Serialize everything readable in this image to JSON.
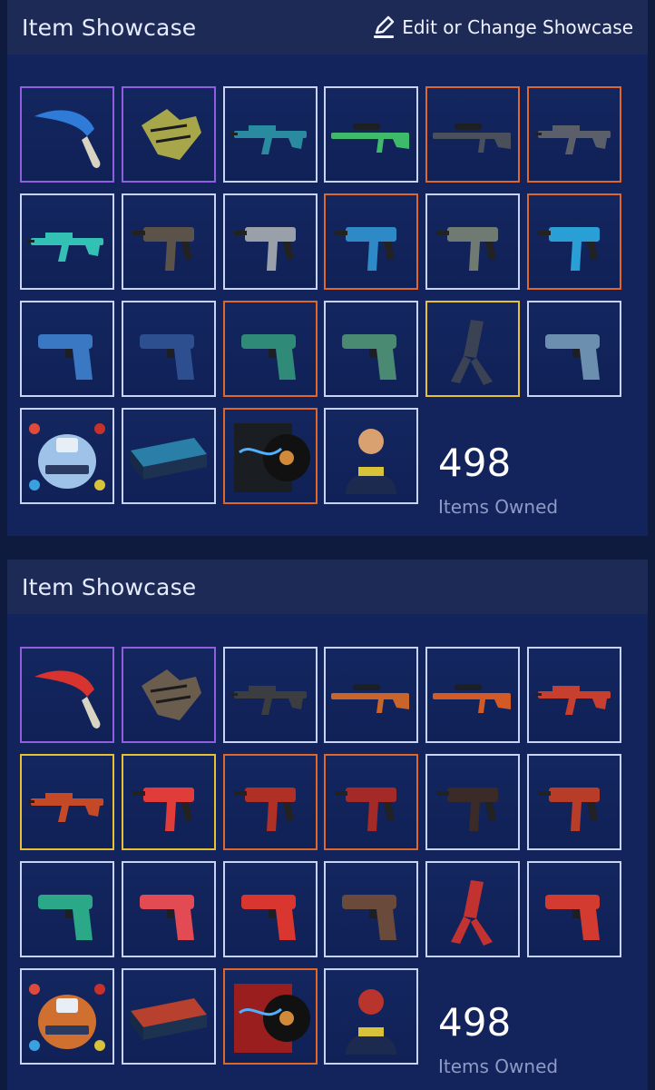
{
  "colors": {
    "background": "#0f1a3f",
    "panel": "#13245c",
    "header": "#1d2a55",
    "border_default": "#c9d3f2",
    "border_purple": "#8f5fe0",
    "border_orange": "#e0672a",
    "border_gold": "#e8c132"
  },
  "showcases": [
    {
      "title": "Item Showcase",
      "edit_label": "Edit or Change Showcase",
      "owned_count": "498",
      "owned_label": "Items Owned",
      "items": [
        {
          "name": "karambit-knife",
          "rarity": "purple",
          "icon": "knife-icon",
          "color": "#2f7bd8"
        },
        {
          "name": "gloves",
          "rarity": "purple",
          "icon": "gloves-icon",
          "color": "#a8a64a"
        },
        {
          "name": "m4a1-s-rifle",
          "rarity": "default",
          "icon": "rifle-icon",
          "color": "#2a8aa0"
        },
        {
          "name": "awp-sniper",
          "rarity": "default",
          "icon": "sniper-icon",
          "color": "#3dbb6a"
        },
        {
          "name": "ssg08-sniper",
          "rarity": "orange",
          "icon": "sniper-icon",
          "color": "#4a4f5c"
        },
        {
          "name": "aug-rifle",
          "rarity": "orange",
          "icon": "rifle-icon",
          "color": "#5a5f6a"
        },
        {
          "name": "famas-rifle",
          "rarity": "default",
          "icon": "rifle-icon",
          "color": "#33c0b5"
        },
        {
          "name": "pp-bizon-smg",
          "rarity": "default",
          "icon": "smg-icon",
          "color": "#5b524a"
        },
        {
          "name": "mp7-smg",
          "rarity": "default",
          "icon": "smg-icon",
          "color": "#9aa0aa"
        },
        {
          "name": "mp9-smg",
          "rarity": "orange",
          "icon": "smg-icon",
          "color": "#2d8ac6"
        },
        {
          "name": "p90-smg",
          "rarity": "default",
          "icon": "smg-icon",
          "color": "#6f7a72"
        },
        {
          "name": "ump45-smg",
          "rarity": "orange",
          "icon": "smg-icon",
          "color": "#2a9fd6"
        },
        {
          "name": "glock-pistol",
          "rarity": "default",
          "icon": "pistol-icon",
          "color": "#3b78c4"
        },
        {
          "name": "usp-s-pistol",
          "rarity": "default",
          "icon": "pistol-icon",
          "color": "#2e4f8f"
        },
        {
          "name": "p250-pistol",
          "rarity": "orange",
          "icon": "pistol-icon",
          "color": "#2f8a78"
        },
        {
          "name": "five-seven-pistol",
          "rarity": "default",
          "icon": "pistol-icon",
          "color": "#4a8a72"
        },
        {
          "name": "dual-berettas-pistol",
          "rarity": "gold",
          "icon": "dual-pistol-icon",
          "color": "#3a4254"
        },
        {
          "name": "desert-eagle-pistol",
          "rarity": "default",
          "icon": "pistol-icon",
          "color": "#6c8fb0"
        },
        {
          "name": "legends-sticker-capsule",
          "rarity": "default",
          "icon": "capsule-icon",
          "color": "#9fc2e8"
        },
        {
          "name": "souvenir-package",
          "rarity": "default",
          "icon": "package-icon",
          "color": "#2a7fa8"
        },
        {
          "name": "music-kit",
          "rarity": "orange",
          "icon": "music-kit-icon",
          "color": "#1a1d22"
        },
        {
          "name": "fbi-agent",
          "rarity": "default",
          "icon": "agent-icon",
          "color": "#d9a070"
        }
      ]
    },
    {
      "title": "Item Showcase",
      "edit_label": "",
      "owned_count": "498",
      "owned_label": "Items Owned",
      "items": [
        {
          "name": "huntsman-knife",
          "rarity": "purple",
          "icon": "knife-icon",
          "color": "#d8332e"
        },
        {
          "name": "gloves",
          "rarity": "purple",
          "icon": "gloves-icon",
          "color": "#6a5d4e"
        },
        {
          "name": "ak47-rifle",
          "rarity": "default",
          "icon": "rifle-icon",
          "color": "#3b3d40"
        },
        {
          "name": "awp-sniper",
          "rarity": "default",
          "icon": "sniper-icon",
          "color": "#c9642a"
        },
        {
          "name": "ssg08-sniper",
          "rarity": "default",
          "icon": "sniper-icon",
          "color": "#d25a26"
        },
        {
          "name": "sg553-rifle",
          "rarity": "default",
          "icon": "rifle-icon",
          "color": "#c7402f"
        },
        {
          "name": "galil-rifle",
          "rarity": "gold",
          "icon": "rifle-icon",
          "color": "#c44a27"
        },
        {
          "name": "pp-bizon-smg",
          "rarity": "gold",
          "icon": "smg-icon",
          "color": "#e03c3a"
        },
        {
          "name": "mac10-smg",
          "rarity": "orange",
          "icon": "smg-icon",
          "color": "#b03026"
        },
        {
          "name": "mp9-smg",
          "rarity": "orange",
          "icon": "smg-icon",
          "color": "#a32a26"
        },
        {
          "name": "p90-smg",
          "rarity": "default",
          "icon": "smg-icon",
          "color": "#3a2a28"
        },
        {
          "name": "ump45-smg",
          "rarity": "default",
          "icon": "smg-icon",
          "color": "#b83d28"
        },
        {
          "name": "zeus-taser",
          "rarity": "default",
          "icon": "pistol-icon",
          "color": "#2aa888"
        },
        {
          "name": "glock-pistol",
          "rarity": "default",
          "icon": "pistol-icon",
          "color": "#e24a54"
        },
        {
          "name": "p250-pistol",
          "rarity": "default",
          "icon": "pistol-icon",
          "color": "#d8362e"
        },
        {
          "name": "tec9-pistol",
          "rarity": "default",
          "icon": "pistol-icon",
          "color": "#6a4a3a"
        },
        {
          "name": "dual-berettas-pistol",
          "rarity": "default",
          "icon": "dual-pistol-icon",
          "color": "#c23230"
        },
        {
          "name": "desert-eagle-pistol",
          "rarity": "default",
          "icon": "pistol-icon",
          "color": "#d33a30"
        },
        {
          "name": "legends-sticker-capsule",
          "rarity": "default",
          "icon": "capsule-icon",
          "color": "#d07030"
        },
        {
          "name": "souvenir-package",
          "rarity": "default",
          "icon": "package-icon",
          "color": "#b8402e"
        },
        {
          "name": "music-kit",
          "rarity": "orange",
          "icon": "music-kit-icon",
          "color": "#9a1e1e"
        },
        {
          "name": "phoenix-agent",
          "rarity": "default",
          "icon": "agent-icon",
          "color": "#b8342c"
        }
      ]
    }
  ]
}
